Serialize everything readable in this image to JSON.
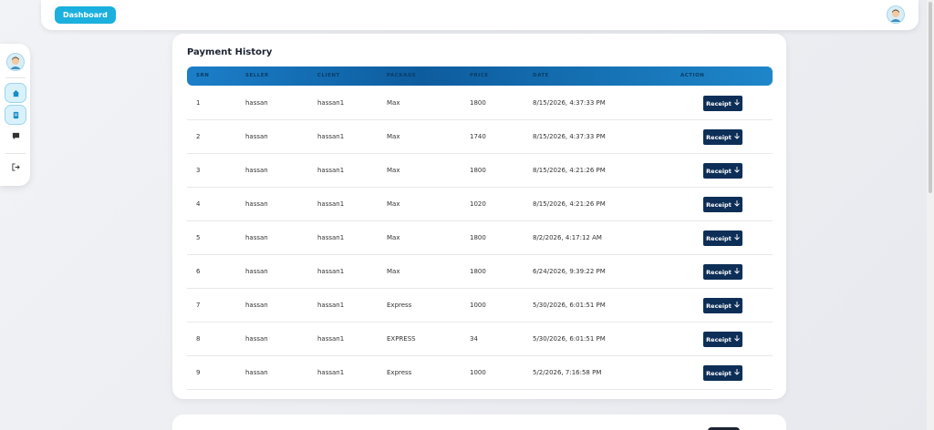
{
  "header": {
    "dashboard_label": "Dashboard"
  },
  "sidebar": {
    "items": [
      {
        "icon": "home-icon",
        "active": true
      },
      {
        "icon": "document-icon",
        "active": true
      },
      {
        "icon": "chat-icon",
        "active": false
      },
      {
        "icon": "logout-icon",
        "active": false
      }
    ]
  },
  "payment_history": {
    "title": "Payment History",
    "columns": [
      "SRN",
      "SELLER",
      "CLIENT",
      "PACKAGE",
      "PRICE",
      "DATE",
      "ACTION"
    ],
    "receipt_label": "Receipt",
    "rows": [
      {
        "srn": "1",
        "seller": "hassan",
        "client": "hassan1",
        "package": "Max",
        "price": "1800",
        "date": "8/15/2026, 4:37:33 PM"
      },
      {
        "srn": "2",
        "seller": "hassan",
        "client": "hassan1",
        "package": "Max",
        "price": "1740",
        "date": "8/15/2026, 4:37:33 PM"
      },
      {
        "srn": "3",
        "seller": "hassan",
        "client": "hassan1",
        "package": "Max",
        "price": "1800",
        "date": "8/15/2026, 4:21:26 PM"
      },
      {
        "srn": "4",
        "seller": "hassan",
        "client": "hassan1",
        "package": "Max",
        "price": "1020",
        "date": "8/15/2026, 4:21:26 PM"
      },
      {
        "srn": "5",
        "seller": "hassan",
        "client": "hassan1",
        "package": "Max",
        "price": "1800",
        "date": "8/2/2026, 4:17:12 AM"
      },
      {
        "srn": "6",
        "seller": "hassan",
        "client": "hassan1",
        "package": "Max",
        "price": "1800",
        "date": "6/24/2026, 9:39:22 PM"
      },
      {
        "srn": "7",
        "seller": "hassan",
        "client": "hassan1",
        "package": "Express",
        "price": "1000",
        "date": "5/30/2026, 6:01:51 PM"
      },
      {
        "srn": "8",
        "seller": "hassan",
        "client": "hassan1",
        "package": "EXPRESS",
        "price": "34",
        "date": "5/30/2026, 6:01:51 PM"
      },
      {
        "srn": "9",
        "seller": "hassan",
        "client": "hassan1",
        "package": "Express",
        "price": "1000",
        "date": "5/2/2026, 7:16:58 PM"
      }
    ]
  },
  "next_section": {
    "title": ""
  },
  "colors": {
    "accent": "#1bb0de",
    "header": "#0d5c9e",
    "button": "#0d2f57"
  }
}
